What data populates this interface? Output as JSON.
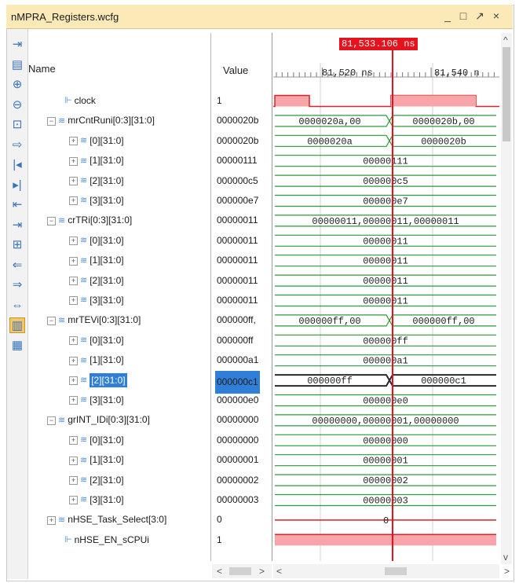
{
  "window": {
    "title": "nMPRA_Registers.wcfg",
    "minimize": "_",
    "restore": "□",
    "float": "↗",
    "close": "×"
  },
  "columns": {
    "name": "Name",
    "value": "Value"
  },
  "cursor": {
    "time_label": "81,533.106 ns",
    "color": "#e8121c"
  },
  "timeline": {
    "labels": [
      "81,520 ns",
      "81,540 n"
    ]
  },
  "toolbar_icons": [
    "zoom-fit-icon",
    "save-icon",
    "zoom-in-icon",
    "zoom-out-icon",
    "zoom-full-icon",
    "go-cursor-icon",
    "go-start-icon",
    "go-end-icon",
    "prev-transition-icon",
    "next-transition-icon",
    "add-marker-icon",
    "prev-marker-icon",
    "next-marker-icon",
    "swap-cursors-icon",
    "snap-icon",
    "grid-icon"
  ],
  "rows": [
    {
      "name": "clock",
      "value": "1",
      "indent": 1,
      "type": "bit",
      "expander": "",
      "wave": {
        "kind": "clock"
      }
    },
    {
      "name": "mrCntRuni[0:3][31:0]",
      "value": "0000020b",
      "indent": 0,
      "type": "bus",
      "expander": "−",
      "wave": {
        "kind": "change",
        "left": "0000020a,00",
        "right": "0000020b,00"
      }
    },
    {
      "name": "[0][31:0]",
      "value": "0000020b",
      "indent": 2,
      "type": "bus",
      "expander": "+",
      "wave": {
        "kind": "change",
        "left": "0000020a",
        "right": "0000020b"
      }
    },
    {
      "name": "[1][31:0]",
      "value": "00000111",
      "indent": 2,
      "type": "bus",
      "expander": "+",
      "wave": {
        "kind": "const",
        "text": "00000111"
      }
    },
    {
      "name": "[2][31:0]",
      "value": "000000c5",
      "indent": 2,
      "type": "bus",
      "expander": "+",
      "wave": {
        "kind": "const",
        "text": "000000c5"
      }
    },
    {
      "name": "[3][31:0]",
      "value": "000000e7",
      "indent": 2,
      "type": "bus",
      "expander": "+",
      "wave": {
        "kind": "const",
        "text": "000000e7"
      }
    },
    {
      "name": "crTRi[0:3][31:0]",
      "value": "00000011",
      "indent": 0,
      "type": "bus",
      "expander": "−",
      "wave": {
        "kind": "const",
        "text": "00000011,00000011,00000011"
      }
    },
    {
      "name": "[0][31:0]",
      "value": "00000011",
      "indent": 2,
      "type": "bus",
      "expander": "+",
      "wave": {
        "kind": "const",
        "text": "00000011"
      }
    },
    {
      "name": "[1][31:0]",
      "value": "00000011",
      "indent": 2,
      "type": "bus",
      "expander": "+",
      "wave": {
        "kind": "const",
        "text": "00000011"
      }
    },
    {
      "name": "[2][31:0]",
      "value": "00000011",
      "indent": 2,
      "type": "bus",
      "expander": "+",
      "wave": {
        "kind": "const",
        "text": "00000011"
      }
    },
    {
      "name": "[3][31:0]",
      "value": "00000011",
      "indent": 2,
      "type": "bus",
      "expander": "+",
      "wave": {
        "kind": "const",
        "text": "00000011"
      }
    },
    {
      "name": "mrTEVi[0:3][31:0]",
      "value": "000000ff,",
      "indent": 0,
      "type": "bus",
      "expander": "−",
      "wave": {
        "kind": "change",
        "left": "000000ff,00",
        "right": "000000ff,00"
      }
    },
    {
      "name": "[0][31:0]",
      "value": "000000ff",
      "indent": 2,
      "type": "bus",
      "expander": "+",
      "wave": {
        "kind": "const",
        "text": "000000ff"
      }
    },
    {
      "name": "[1][31:0]",
      "value": "000000a1",
      "indent": 2,
      "type": "bus",
      "expander": "+",
      "wave": {
        "kind": "const",
        "text": "000000a1"
      }
    },
    {
      "name": "[2][31:0]",
      "value": "000000c1",
      "indent": 2,
      "type": "bus",
      "expander": "+",
      "selected": true,
      "wave": {
        "kind": "change",
        "left": "000000ff",
        "right": "000000c1"
      }
    },
    {
      "name": "[3][31:0]",
      "value": "000000e0",
      "indent": 2,
      "type": "bus",
      "expander": "+",
      "wave": {
        "kind": "const",
        "text": "000000e0"
      }
    },
    {
      "name": "grINT_IDi[0:3][31:0]",
      "value": "00000000",
      "indent": 0,
      "type": "bus",
      "expander": "−",
      "wave": {
        "kind": "const",
        "text": "00000000,00000001,00000000"
      }
    },
    {
      "name": "[0][31:0]",
      "value": "00000000",
      "indent": 2,
      "type": "bus",
      "expander": "+",
      "wave": {
        "kind": "const",
        "text": "00000000"
      }
    },
    {
      "name": "[1][31:0]",
      "value": "00000001",
      "indent": 2,
      "type": "bus",
      "expander": "+",
      "wave": {
        "kind": "const",
        "text": "00000001"
      }
    },
    {
      "name": "[2][31:0]",
      "value": "00000002",
      "indent": 2,
      "type": "bus",
      "expander": "+",
      "wave": {
        "kind": "const",
        "text": "00000002"
      }
    },
    {
      "name": "[3][31:0]",
      "value": "00000003",
      "indent": 2,
      "type": "bus",
      "expander": "+",
      "wave": {
        "kind": "const",
        "text": "00000003"
      }
    },
    {
      "name": "nHSE_Task_Select[3:0]",
      "value": "0",
      "indent": 0,
      "type": "bus",
      "expander": "+",
      "wave": {
        "kind": "const",
        "text": "0"
      }
    },
    {
      "name": "nHSE_EN_sCPUi",
      "value": "1",
      "indent": 1,
      "type": "bit",
      "expander": "",
      "wave": {
        "kind": "high"
      }
    }
  ],
  "scroll": {
    "left": "<",
    "right": ">",
    "up": "^",
    "down": "v"
  }
}
